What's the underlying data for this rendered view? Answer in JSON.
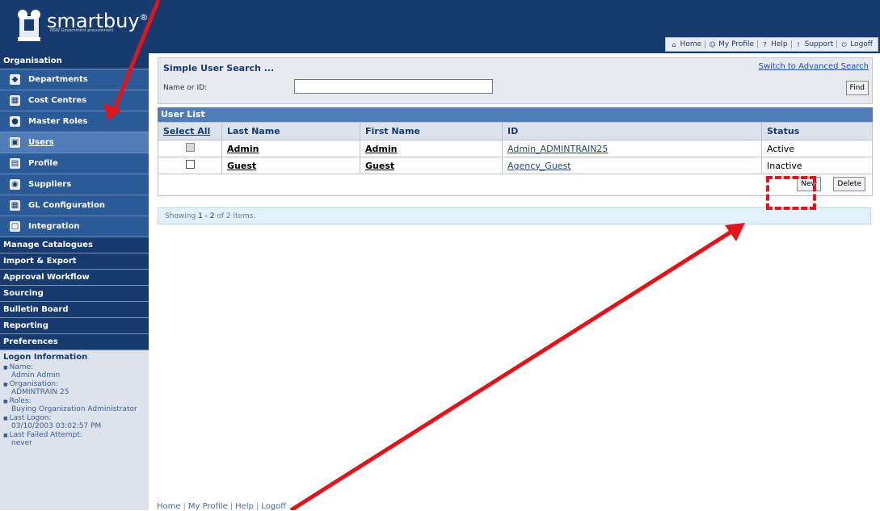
{
  "header": {
    "brand": "smartbuy",
    "brand_mark": "®",
    "tagline": "NSW Government procurement",
    "nav": [
      {
        "icon": "home-icon",
        "glyph": "⌂",
        "label": "Home"
      },
      {
        "icon": "profile-icon",
        "glyph": "☺",
        "label": "My Profile"
      },
      {
        "icon": "help-icon",
        "glyph": "?",
        "label": "Help"
      },
      {
        "icon": "support-icon",
        "glyph": "!",
        "label": "Support"
      },
      {
        "icon": "logoff-icon",
        "glyph": "⏻",
        "label": "Logoff"
      }
    ]
  },
  "sidebar": {
    "organisation": "Organisation",
    "items": [
      {
        "label": "Departments",
        "icon": "departments-icon",
        "glyph": "◆"
      },
      {
        "label": "Cost Centres",
        "icon": "cost-centres-icon",
        "glyph": "▦"
      },
      {
        "label": "Master Roles",
        "icon": "master-roles-icon",
        "glyph": "●"
      },
      {
        "label": "Users",
        "icon": "users-icon",
        "glyph": "▣"
      },
      {
        "label": "Profile",
        "icon": "profile-icon",
        "glyph": "▤"
      },
      {
        "label": "Suppliers",
        "icon": "suppliers-icon",
        "glyph": "◉"
      },
      {
        "label": "GL Configuration",
        "icon": "gl-configuration-icon",
        "glyph": "▦"
      },
      {
        "label": "Integration",
        "icon": "integration-icon",
        "glyph": "▢"
      }
    ],
    "sections": [
      "Manage Catalogues",
      "Import & Export",
      "Approval Workflow",
      "Sourcing",
      "Bulletin Board",
      "Reporting",
      "Preferences"
    ],
    "logon": {
      "title": "Logon Information",
      "name_label": "Name:",
      "name": "Admin Admin",
      "org_label": "Organisation:",
      "org": "ADMINTRAIN 25",
      "roles_label": "Roles:",
      "roles": "Buying Organization Administrator",
      "last_label": "Last Logon:",
      "last": "03/10/2003 03:02:57 PM",
      "failed_label": "Last Failed Attempt:",
      "failed": "never"
    }
  },
  "search": {
    "title": "Simple User Search ...",
    "advanced": "Switch to Advanced Search",
    "label": "Name or ID:",
    "value": "",
    "find": "Find"
  },
  "userlist": {
    "title": "User List",
    "columns": [
      "Select All",
      "Last Name",
      "First Name",
      "ID",
      "Status"
    ],
    "rows": [
      {
        "last": "Admin",
        "first": "Admin",
        "id": "Admin_ADMINTRAIN25",
        "status": "Active"
      },
      {
        "last": "Guest",
        "first": "Guest",
        "id": "Agency_Guest",
        "status": "Inactive"
      }
    ],
    "new": "New",
    "delete": "Delete",
    "showing_prefix": "Showing ",
    "showing_range": "1 - 2",
    "showing_suffix": " of 2 items."
  },
  "footer": [
    "Home",
    "My Profile",
    "Help",
    "Logoff"
  ],
  "colors": {
    "annotation": "#e0141b",
    "header": "#173b6f"
  }
}
